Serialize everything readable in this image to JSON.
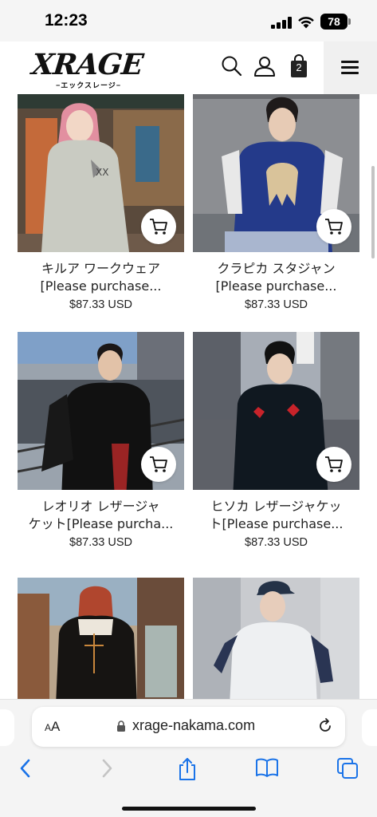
{
  "status_bar": {
    "time": "12:23",
    "battery": "78"
  },
  "header": {
    "logo_main": "XRAGE",
    "logo_sub": "−エックスレージ−",
    "cart_count": "2",
    "icons": [
      "search-icon",
      "user-icon",
      "shopping-bag-icon",
      "hamburger-menu-icon"
    ]
  },
  "products": [
    {
      "name_line1": "キルア ワークウェア",
      "name_line2": "[Please purchase...",
      "price": "$87.33 USD"
    },
    {
      "name_line1": "クラピカ スタジャン",
      "name_line2": "[Please purchase...",
      "price": "$87.33 USD"
    },
    {
      "name_line1": "レオリオ レザージャ",
      "name_line2": "ケット[Please purcha...",
      "price": "$87.33 USD"
    },
    {
      "name_line1": "ヒソカ レザージャケッ",
      "name_line2": "ト[Please purchase...",
      "price": "$87.33 USD"
    },
    {
      "name_line1": "",
      "name_line2": "",
      "price": ""
    },
    {
      "name_line1": "",
      "name_line2": "",
      "price": ""
    }
  ],
  "browser": {
    "aa_label": "AA",
    "url": "xrage-nakama.com",
    "toolbar_icons": [
      "back-icon",
      "forward-icon",
      "share-icon",
      "bookmarks-icon",
      "tabs-icon"
    ]
  },
  "colors": {
    "accent": "#111111",
    "background": "#ffffff",
    "safari_bar": "#f4f4f4",
    "safari_blue": "#1a73e8"
  }
}
